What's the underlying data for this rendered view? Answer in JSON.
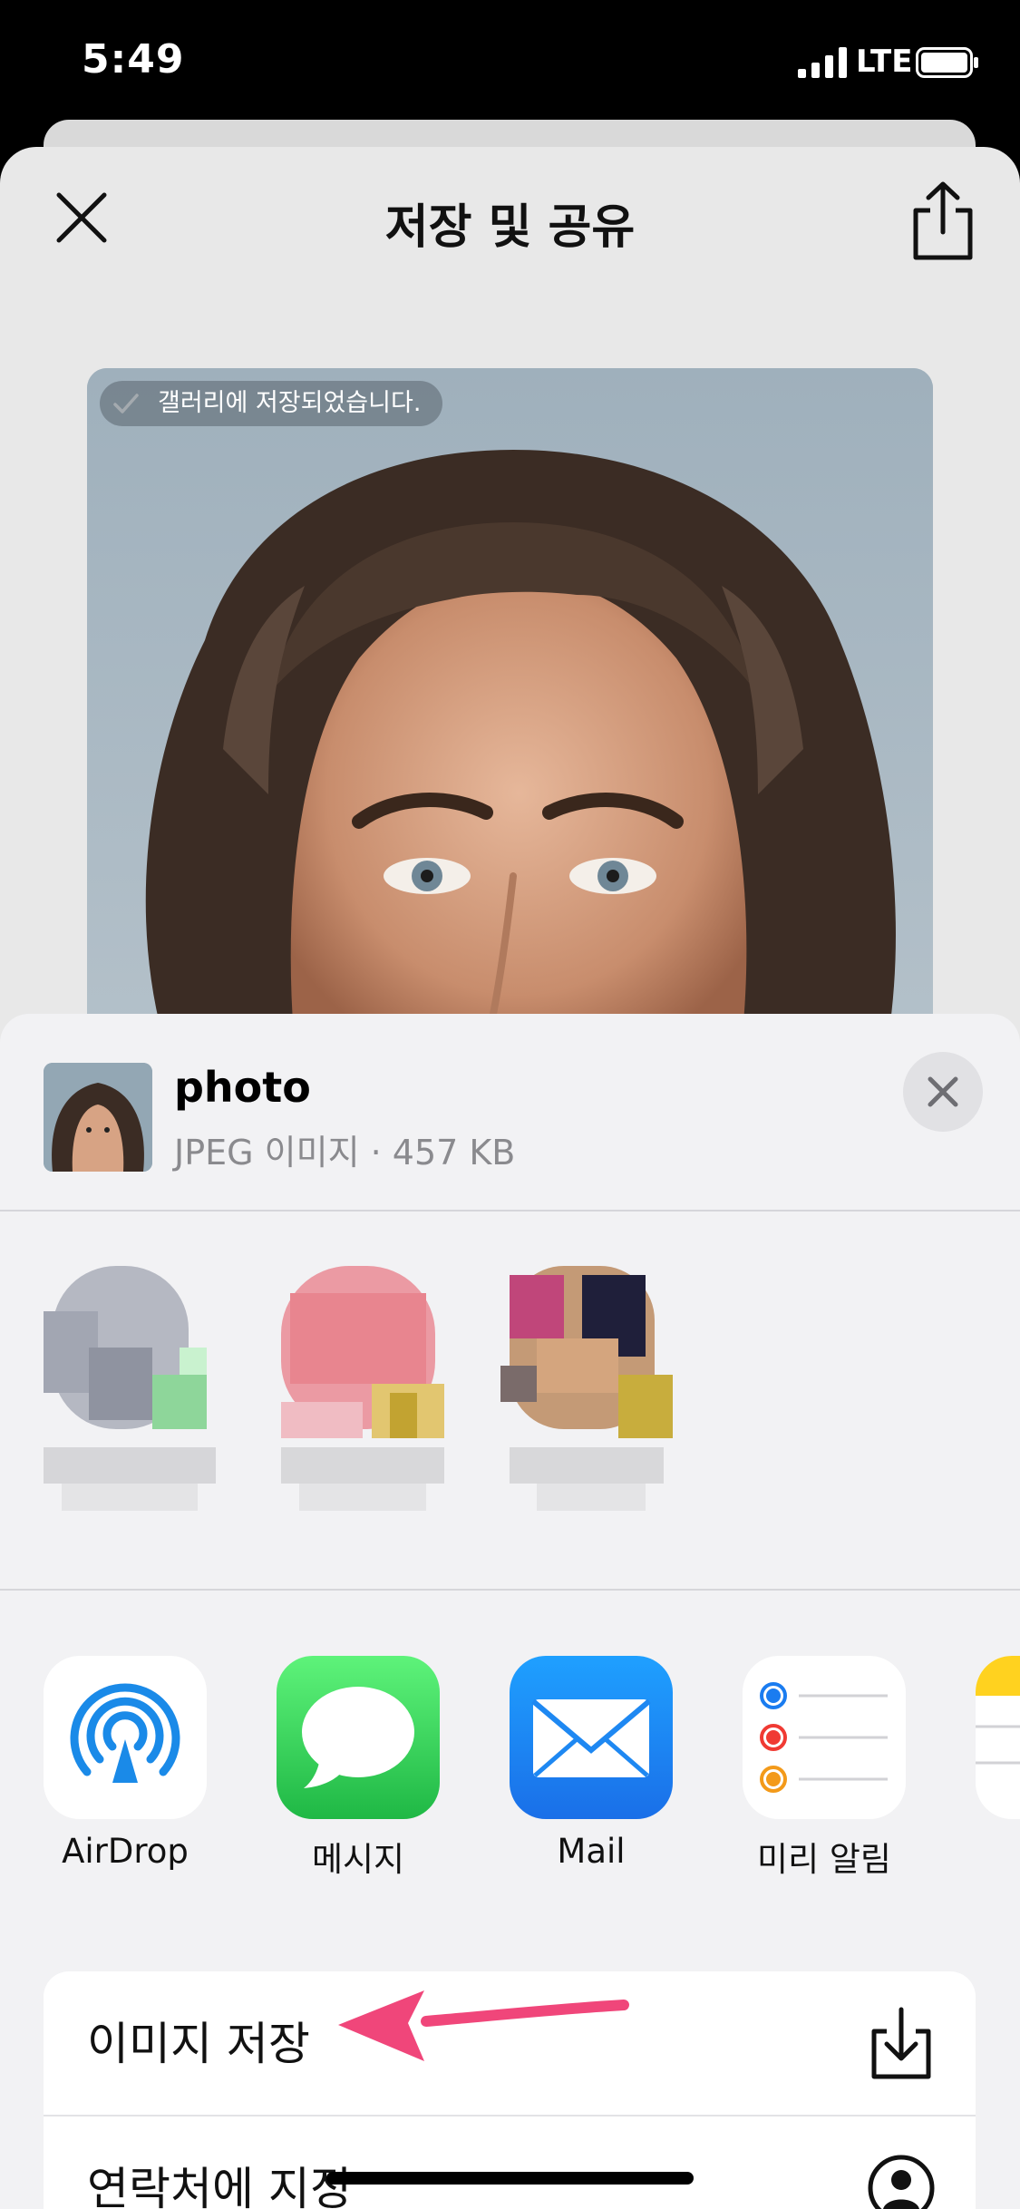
{
  "status_bar": {
    "time": "5:49",
    "network": "LTE"
  },
  "nav": {
    "title": "저장 및 공유"
  },
  "photo": {
    "saved_toast": "갤러리에 저장되었습니다."
  },
  "share": {
    "file_name": "photo",
    "file_meta": "JPEG 이미지 · 457 KB",
    "apps": [
      {
        "label": "AirDrop",
        "icon": "airdrop-icon"
      },
      {
        "label": "메시지",
        "icon": "messages-icon"
      },
      {
        "label": "Mail",
        "icon": "mail-icon"
      },
      {
        "label": "미리 알림",
        "icon": "reminders-icon"
      }
    ],
    "actions": [
      {
        "label": "이미지 저장",
        "icon": "download-icon"
      },
      {
        "label": "연락처에 지정",
        "icon": "contact-icon"
      }
    ]
  },
  "colors": {
    "accent_arrow": "#f0467a",
    "messages_green": "#35c759",
    "mail_blue": "#1e88f2",
    "airdrop_blue": "#1a8ae8"
  }
}
